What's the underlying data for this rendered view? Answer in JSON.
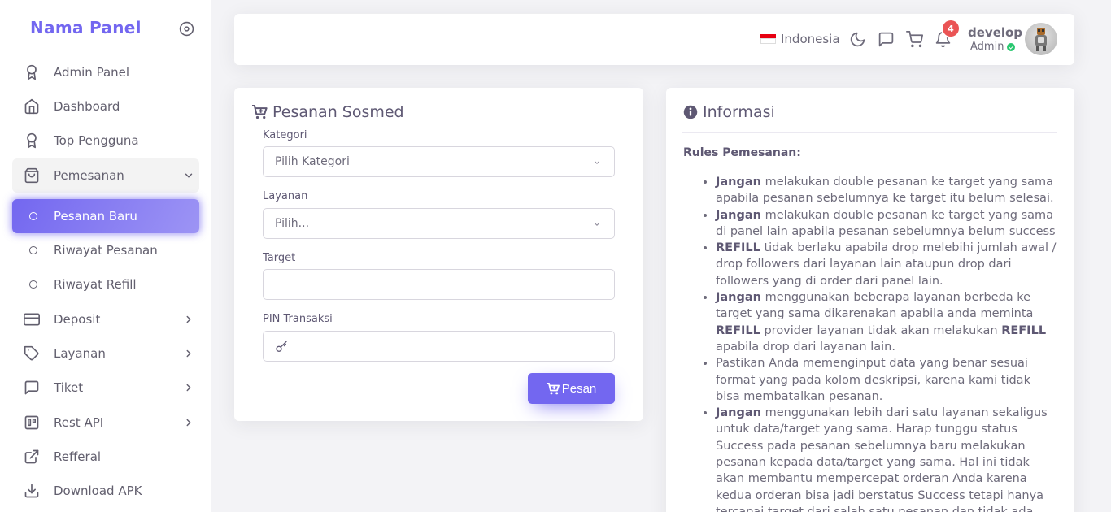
{
  "brand": {
    "title": "Nama Panel"
  },
  "sidebar": {
    "items": [
      {
        "label": "Admin Panel",
        "icon": "award-icon"
      },
      {
        "label": "Dashboard",
        "icon": "home-icon"
      },
      {
        "label": "Top Pengguna",
        "icon": "award-icon"
      },
      {
        "label": "Pemesanan",
        "icon": "shopping-bag-icon"
      },
      {
        "label": "Pesanan Baru",
        "icon": "circle-icon"
      },
      {
        "label": "Riwayat Pesanan",
        "icon": "circle-icon"
      },
      {
        "label": "Riwayat Refill",
        "icon": "circle-icon"
      },
      {
        "label": "Deposit",
        "icon": "credit-card-icon"
      },
      {
        "label": "Layanan",
        "icon": "tag-icon"
      },
      {
        "label": "Tiket",
        "icon": "message-square-icon"
      },
      {
        "label": "Rest API",
        "icon": "trello-icon"
      },
      {
        "label": "Refferal",
        "icon": "external-link-icon"
      },
      {
        "label": "Download APK",
        "icon": "download-icon"
      }
    ]
  },
  "navbar": {
    "language": "Indonesia",
    "notification_count": "4",
    "user_name": "develop",
    "user_role": "Admin"
  },
  "order_form": {
    "title": "Pesanan Sosmed",
    "category_label": "Kategori",
    "category_value": "Pilih Kategori",
    "service_label": "Layanan",
    "service_value": "Pilih...",
    "target_label": "Target",
    "target_value": "",
    "pin_label": "PIN Transaksi",
    "pin_value": "",
    "submit_label": "Pesan"
  },
  "info": {
    "title": "Informasi",
    "rules_title": "Rules Pemesanan:",
    "rules": [
      {
        "bold": "Jangan",
        "text": " melakukan double pesanan ke target yang sama apabila pesanan sebelumnya ke target itu belum selesai."
      },
      {
        "bold": "Jangan",
        "text": " melakukan double pesanan ke target yang sama di panel lain apabila pesanan sebelumnya belum success"
      },
      {
        "bold": "REFILL",
        "text": " tidak berlaku apabila drop melebihi jumlah awal / drop followers dari layanan lain ataupun drop dari followers yang di order dari panel lain."
      },
      {
        "bold": "Jangan",
        "text": " menggunakan beberapa layanan berbeda ke target yang sama dikarenakan apabila anda meminta ",
        "bold2": "REFILL",
        "text2": " provider layanan tidak akan melakukan ",
        "bold3": "REFILL",
        "text3": " apabila drop dari layanan lain."
      },
      {
        "bold": "",
        "text": "Pastikan Anda memenginput data yang benar sesuai format yang pada kolom deskripsi, karena kami tidak bisa membatalkan pesanan."
      },
      {
        "bold": "Jangan",
        "text": " menggunakan lebih dari satu layanan sekaligus untuk data/target yang sama. Harap tunggu status Success pada pesanan sebelumnya baru melakukan pesanan kepada data/target yang sama. Hal ini tidak akan membantu mempercepat orderan Anda karena kedua orderan bisa jadi berstatus Success tetapi hanya tercapai target dari salah satu pesanan dan tidak ada"
      }
    ]
  },
  "colors": {
    "primary": "#7367f0",
    "danger": "#ea5455",
    "success": "#28c76f"
  }
}
